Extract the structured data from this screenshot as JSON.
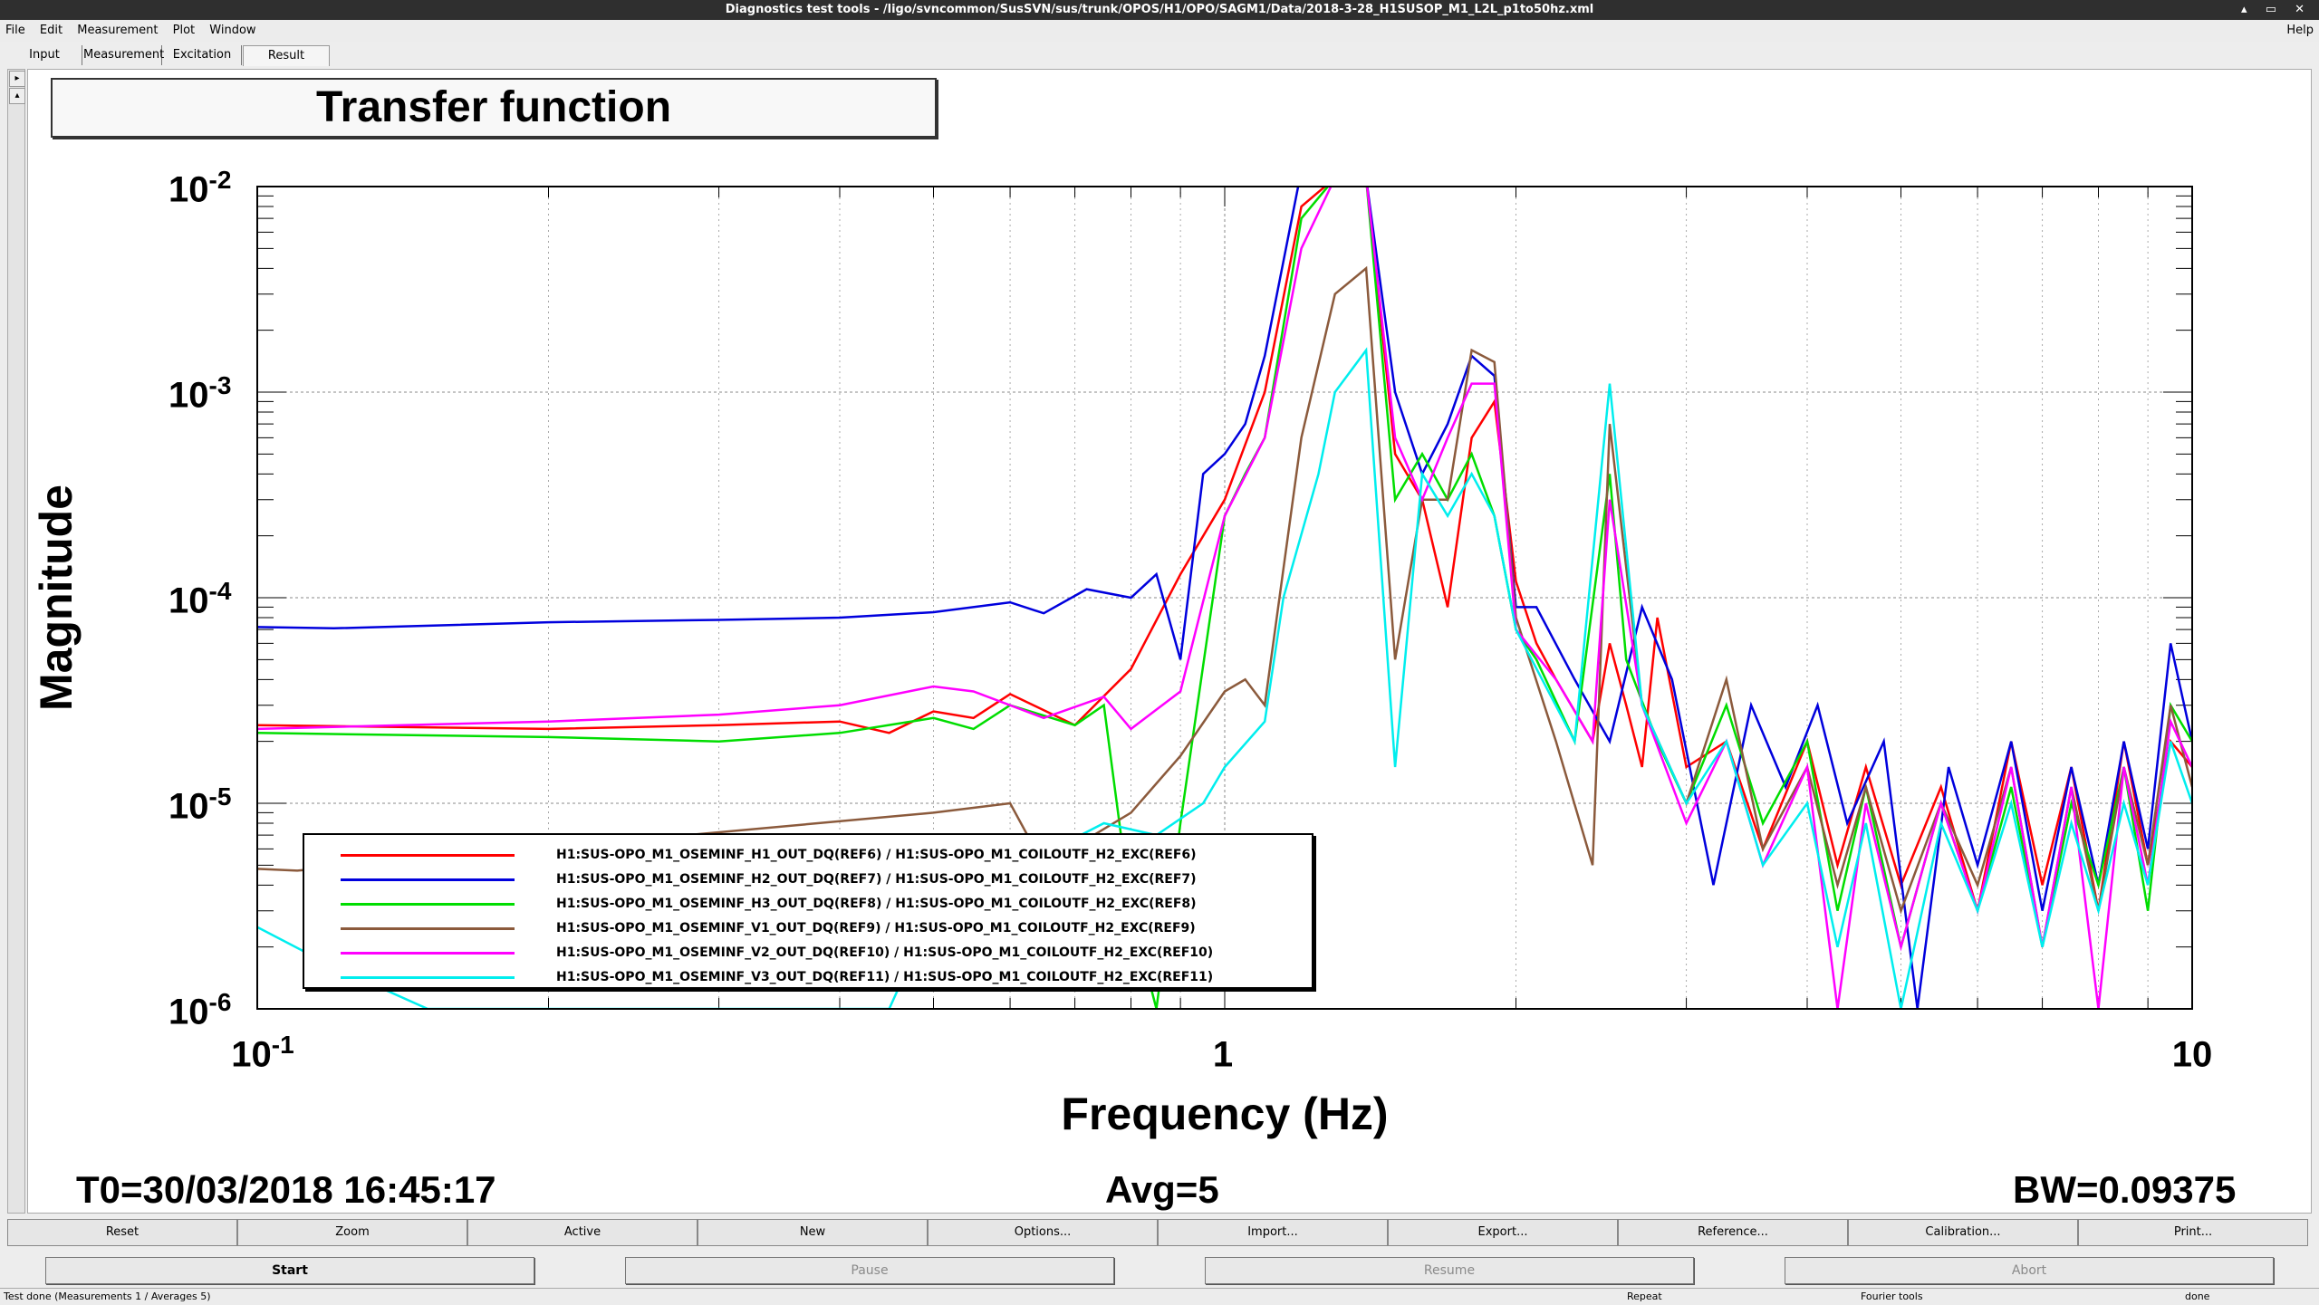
{
  "window": {
    "title": "Diagnostics test tools - /ligo/svncommon/SusSVN/sus/trunk/OPOS/H1/OPO/SAGM1/Data/2018-3-28_H1SUSOP_M1_L2L_p1to50hz.xml",
    "controls": "▴ ▭ ✕"
  },
  "menu": {
    "items": [
      "File",
      "Edit",
      "Measurement",
      "Plot",
      "Window"
    ],
    "help": "Help"
  },
  "tabs": [
    "Input",
    "Measurement",
    "Excitation",
    "Result"
  ],
  "active_tab": "Result",
  "plot": {
    "title": "Transfer function",
    "ylabel": "Magnitude",
    "xlabel": "Frequency (Hz)",
    "yticks": [
      {
        "base": "10",
        "exp": "-2"
      },
      {
        "base": "10",
        "exp": "-3"
      },
      {
        "base": "10",
        "exp": "-4"
      },
      {
        "base": "10",
        "exp": "-5"
      },
      {
        "base": "10",
        "exp": "-6"
      }
    ],
    "xticks": [
      {
        "base": "10",
        "exp": "-1"
      },
      {
        "base": "1",
        "exp": ""
      },
      {
        "base": "10",
        "exp": ""
      }
    ],
    "footer": {
      "t0": "T0=30/03/2018 16:45:17",
      "avg": "Avg=5",
      "bw": "BW=0.09375"
    }
  },
  "chart_data": {
    "type": "line",
    "title": "Transfer function",
    "xlabel": "Frequency (Hz)",
    "ylabel": "Magnitude",
    "xscale": "log",
    "yscale": "log",
    "xlim": [
      0.1,
      10
    ],
    "ylim": [
      1e-06,
      0.01
    ],
    "grid": true,
    "legend_position": "bottom-left",
    "series": [
      {
        "name": "H1:SUS-OPO_M1_OSEMINF_H1_OUT_DQ(REF6) / H1:SUS-OPO_M1_COILOUTF_H2_EXC(REF6)",
        "color": "#ff0000",
        "points": [
          [
            0.1,
            2.4e-05
          ],
          [
            0.2,
            2.3e-05
          ],
          [
            0.3,
            2.4e-05
          ],
          [
            0.4,
            2.5e-05
          ],
          [
            0.45,
            2.2e-05
          ],
          [
            0.5,
            2.8e-05
          ],
          [
            0.55,
            2.6e-05
          ],
          [
            0.6,
            3.4e-05
          ],
          [
            0.7,
            2.4e-05
          ],
          [
            0.8,
            4.5e-05
          ],
          [
            0.9,
            0.00013
          ],
          [
            1.0,
            0.0003
          ],
          [
            1.1,
            0.001
          ],
          [
            1.2,
            0.008
          ],
          [
            1.3,
            0.011
          ],
          [
            1.4,
            0.011
          ],
          [
            1.5,
            0.0005
          ],
          [
            1.6,
            0.0003
          ],
          [
            1.7,
            9e-05
          ],
          [
            1.8,
            0.0006
          ],
          [
            1.9,
            0.0009
          ],
          [
            2.0,
            0.00012
          ],
          [
            2.1,
            6e-05
          ],
          [
            2.2,
            4e-05
          ],
          [
            2.4,
            2e-05
          ],
          [
            2.5,
            6e-05
          ],
          [
            2.6,
            3e-05
          ],
          [
            2.7,
            1.5e-05
          ],
          [
            2.8,
            8e-05
          ],
          [
            3.0,
            1.5e-05
          ],
          [
            3.3,
            2e-05
          ],
          [
            3.6,
            6e-06
          ],
          [
            4.0,
            2e-05
          ],
          [
            4.3,
            5e-06
          ],
          [
            4.6,
            1.5e-05
          ],
          [
            5.0,
            4e-06
          ],
          [
            5.5,
            1.2e-05
          ],
          [
            6.0,
            3e-06
          ],
          [
            6.5,
            2e-05
          ],
          [
            7.0,
            4e-06
          ],
          [
            7.5,
            1.5e-05
          ],
          [
            8.0,
            3e-06
          ],
          [
            8.5,
            2e-05
          ],
          [
            9.0,
            5e-06
          ],
          [
            9.5,
            2e-05
          ],
          [
            10.0,
            1.5e-05
          ]
        ]
      },
      {
        "name": "H1:SUS-OPO_M1_OSEMINF_H2_OUT_DQ(REF7) / H1:SUS-OPO_M1_COILOUTF_H2_EXC(REF7)",
        "color": "#0000dd",
        "points": [
          [
            0.1,
            7.2e-05
          ],
          [
            0.12,
            7.1e-05
          ],
          [
            0.2,
            7.6e-05
          ],
          [
            0.3,
            7.8e-05
          ],
          [
            0.4,
            8e-05
          ],
          [
            0.5,
            8.5e-05
          ],
          [
            0.6,
            9.5e-05
          ],
          [
            0.65,
            8.4e-05
          ],
          [
            0.72,
            0.00011
          ],
          [
            0.8,
            0.0001
          ],
          [
            0.85,
            0.00013
          ],
          [
            0.9,
            5e-05
          ],
          [
            0.95,
            0.0004
          ],
          [
            1.0,
            0.0005
          ],
          [
            1.05,
            0.0007
          ],
          [
            1.1,
            0.0015
          ],
          [
            1.2,
            0.012
          ],
          [
            1.3,
            0.012
          ],
          [
            1.4,
            0.011
          ],
          [
            1.5,
            0.001
          ],
          [
            1.6,
            0.0004
          ],
          [
            1.7,
            0.0007
          ],
          [
            1.8,
            0.0015
          ],
          [
            1.9,
            0.0012
          ],
          [
            2.0,
            9e-05
          ],
          [
            2.1,
            9e-05
          ],
          [
            2.3,
            4e-05
          ],
          [
            2.5,
            2e-05
          ],
          [
            2.7,
            9e-05
          ],
          [
            2.9,
            4e-05
          ],
          [
            3.2,
            4e-06
          ],
          [
            3.5,
            3e-05
          ],
          [
            3.8,
            1.2e-05
          ],
          [
            4.1,
            3e-05
          ],
          [
            4.4,
            8e-06
          ],
          [
            4.8,
            2e-05
          ],
          [
            5.2,
            1e-06
          ],
          [
            5.6,
            1.5e-05
          ],
          [
            6.0,
            5e-06
          ],
          [
            6.5,
            2e-05
          ],
          [
            7.0,
            3e-06
          ],
          [
            7.5,
            1.5e-05
          ],
          [
            8.0,
            4e-06
          ],
          [
            8.5,
            2e-05
          ],
          [
            9.0,
            6e-06
          ],
          [
            9.5,
            6e-05
          ],
          [
            10.0,
            2e-05
          ]
        ]
      },
      {
        "name": "H1:SUS-OPO_M1_OSEMINF_H3_OUT_DQ(REF8) / H1:SUS-OPO_M1_COILOUTF_H2_EXC(REF8)",
        "color": "#00dd00",
        "points": [
          [
            0.1,
            2.2e-05
          ],
          [
            0.2,
            2.1e-05
          ],
          [
            0.3,
            2e-05
          ],
          [
            0.4,
            2.2e-05
          ],
          [
            0.5,
            2.6e-05
          ],
          [
            0.55,
            2.3e-05
          ],
          [
            0.6,
            3e-05
          ],
          [
            0.7,
            2.4e-05
          ],
          [
            0.75,
            3e-05
          ],
          [
            0.8,
            3e-06
          ],
          [
            0.85,
            1e-06
          ],
          [
            0.9,
            8e-06
          ],
          [
            1.0,
            0.00025
          ],
          [
            1.05,
            0.0004
          ],
          [
            1.1,
            0.0006
          ],
          [
            1.2,
            0.007
          ],
          [
            1.3,
            0.011
          ],
          [
            1.4,
            0.011
          ],
          [
            1.5,
            0.0003
          ],
          [
            1.6,
            0.0005
          ],
          [
            1.7,
            0.0003
          ],
          [
            1.8,
            0.0005
          ],
          [
            1.9,
            0.00025
          ],
          [
            2.0,
            7e-05
          ],
          [
            2.1,
            5e-05
          ],
          [
            2.3,
            2e-05
          ],
          [
            2.5,
            0.0004
          ],
          [
            2.6,
            5e-05
          ],
          [
            2.8,
            2e-05
          ],
          [
            3.0,
            1e-05
          ],
          [
            3.3,
            3e-05
          ],
          [
            3.6,
            8e-06
          ],
          [
            4.0,
            2e-05
          ],
          [
            4.3,
            3e-06
          ],
          [
            4.6,
            1.2e-05
          ],
          [
            5.0,
            2e-06
          ],
          [
            5.5,
            1e-05
          ],
          [
            6.0,
            3e-06
          ],
          [
            6.5,
            1.2e-05
          ],
          [
            7.0,
            2e-06
          ],
          [
            7.5,
            1e-05
          ],
          [
            8.0,
            4e-06
          ],
          [
            8.5,
            1.5e-05
          ],
          [
            9.0,
            3e-06
          ],
          [
            9.5,
            3e-05
          ],
          [
            10.0,
            2e-05
          ]
        ]
      },
      {
        "name": "H1:SUS-OPO_M1_OSEMINF_V1_OUT_DQ(REF9) / H1:SUS-OPO_M1_COILOUTF_H2_EXC(REF9)",
        "color": "#8b5a3c",
        "points": [
          [
            0.1,
            4.8e-06
          ],
          [
            0.11,
            4.7e-06
          ],
          [
            0.5,
            9e-06
          ],
          [
            0.6,
            1e-05
          ],
          [
            0.65,
            5e-06
          ],
          [
            0.8,
            9e-06
          ],
          [
            0.9,
            1.7e-05
          ],
          [
            1.0,
            3.5e-05
          ],
          [
            1.05,
            4e-05
          ],
          [
            1.1,
            3e-05
          ],
          [
            1.2,
            0.0006
          ],
          [
            1.3,
            0.003
          ],
          [
            1.4,
            0.004
          ],
          [
            1.5,
            5e-05
          ],
          [
            1.6,
            0.0003
          ],
          [
            1.7,
            0.0003
          ],
          [
            1.8,
            0.0016
          ],
          [
            1.9,
            0.0014
          ],
          [
            2.0,
            8e-05
          ],
          [
            2.2,
            2e-05
          ],
          [
            2.4,
            5e-06
          ],
          [
            2.5,
            0.0007
          ],
          [
            2.7,
            3e-05
          ],
          [
            3.0,
            1e-05
          ],
          [
            3.3,
            4e-05
          ],
          [
            3.6,
            6e-06
          ],
          [
            4.0,
            1.5e-05
          ],
          [
            4.3,
            4e-06
          ],
          [
            4.6,
            1.2e-05
          ],
          [
            5.0,
            3e-06
          ],
          [
            5.5,
            1e-05
          ],
          [
            6.0,
            4e-06
          ],
          [
            6.5,
            1.5e-05
          ],
          [
            7.0,
            2e-06
          ],
          [
            7.5,
            1.2e-05
          ],
          [
            8.0,
            3e-06
          ],
          [
            8.5,
            1.5e-05
          ],
          [
            9.0,
            5e-06
          ],
          [
            9.5,
            3e-05
          ],
          [
            10.0,
            1.2e-05
          ]
        ]
      },
      {
        "name": "H1:SUS-OPO_M1_OSEMINF_V2_OUT_DQ(REF10) / H1:SUS-OPO_M1_COILOUTF_H2_EXC(REF10)",
        "color": "#ff00ff",
        "points": [
          [
            0.1,
            2.3e-05
          ],
          [
            0.2,
            2.5e-05
          ],
          [
            0.3,
            2.7e-05
          ],
          [
            0.4,
            3e-05
          ],
          [
            0.5,
            3.7e-05
          ],
          [
            0.55,
            3.5e-05
          ],
          [
            0.65,
            2.6e-05
          ],
          [
            0.75,
            3.3e-05
          ],
          [
            0.8,
            2.3e-05
          ],
          [
            0.9,
            3.5e-05
          ],
          [
            1.0,
            0.00025
          ],
          [
            1.1,
            0.0006
          ],
          [
            1.2,
            0.005
          ],
          [
            1.3,
            0.011
          ],
          [
            1.4,
            0.011
          ],
          [
            1.5,
            0.0006
          ],
          [
            1.6,
            0.0003
          ],
          [
            1.7,
            0.0006
          ],
          [
            1.8,
            0.0011
          ],
          [
            1.9,
            0.0011
          ],
          [
            2.0,
            7e-05
          ],
          [
            2.2,
            4e-05
          ],
          [
            2.4,
            2e-05
          ],
          [
            2.5,
            0.0003
          ],
          [
            2.7,
            3e-05
          ],
          [
            3.0,
            8e-06
          ],
          [
            3.3,
            2e-05
          ],
          [
            3.6,
            5e-06
          ],
          [
            4.0,
            1.5e-05
          ],
          [
            4.3,
            1e-06
          ],
          [
            4.6,
            1e-05
          ],
          [
            5.0,
            2e-06
          ],
          [
            5.5,
            1e-05
          ],
          [
            6.0,
            3e-06
          ],
          [
            6.5,
            1.5e-05
          ],
          [
            7.0,
            2e-06
          ],
          [
            7.5,
            1.2e-05
          ],
          [
            8.0,
            1e-06
          ],
          [
            8.5,
            1.5e-05
          ],
          [
            9.0,
            4e-06
          ],
          [
            9.5,
            2.5e-05
          ],
          [
            10.0,
            1.5e-05
          ]
        ]
      },
      {
        "name": "H1:SUS-OPO_M1_OSEMINF_V3_OUT_DQ(REF11) / H1:SUS-OPO_M1_COILOUTF_H2_EXC(REF11)",
        "color": "#00eeee",
        "points": [
          [
            0.1,
            2.5e-06
          ],
          [
            0.12,
            1.6e-06
          ],
          [
            0.15,
            1e-06
          ],
          [
            0.45,
            1e-06
          ],
          [
            0.5,
            3e-06
          ],
          [
            0.75,
            8e-06
          ],
          [
            0.85,
            7e-06
          ],
          [
            0.95,
            1e-05
          ],
          [
            1.0,
            1.5e-05
          ],
          [
            1.1,
            2.5e-05
          ],
          [
            1.15,
            0.0001
          ],
          [
            1.25,
            0.0004
          ],
          [
            1.3,
            0.001
          ],
          [
            1.4,
            0.0016
          ],
          [
            1.5,
            1.5e-05
          ],
          [
            1.6,
            0.0004
          ],
          [
            1.7,
            0.00025
          ],
          [
            1.8,
            0.0004
          ],
          [
            1.9,
            0.00025
          ],
          [
            2.0,
            7e-05
          ],
          [
            2.3,
            2e-05
          ],
          [
            2.5,
            0.0011
          ],
          [
            2.7,
            3e-05
          ],
          [
            3.0,
            1e-05
          ],
          [
            3.3,
            2e-05
          ],
          [
            3.6,
            5e-06
          ],
          [
            4.0,
            1e-05
          ],
          [
            4.3,
            2e-06
          ],
          [
            4.6,
            8e-06
          ],
          [
            5.0,
            1e-06
          ],
          [
            5.5,
            8e-06
          ],
          [
            6.0,
            3e-06
          ],
          [
            6.5,
            1e-05
          ],
          [
            7.0,
            2e-06
          ],
          [
            7.5,
            8e-06
          ],
          [
            8.0,
            3e-06
          ],
          [
            8.5,
            1e-05
          ],
          [
            9.0,
            4e-06
          ],
          [
            9.5,
            2e-05
          ],
          [
            10.0,
            1e-05
          ]
        ]
      }
    ]
  },
  "buttons_row1": [
    "Reset",
    "Zoom",
    "Active",
    "New",
    "Options...",
    "Import...",
    "Export...",
    "Reference...",
    "Calibration...",
    "Print..."
  ],
  "buttons_row2": [
    {
      "label": "Start",
      "enabled": true
    },
    {
      "label": "Pause",
      "enabled": false
    },
    {
      "label": "Resume",
      "enabled": false
    },
    {
      "label": "Abort",
      "enabled": false
    }
  ],
  "status": {
    "left": "Test done (Measurements 1 / Averages 5)",
    "repeat": "Repeat",
    "tools": "Fourier tools",
    "state": "done"
  }
}
